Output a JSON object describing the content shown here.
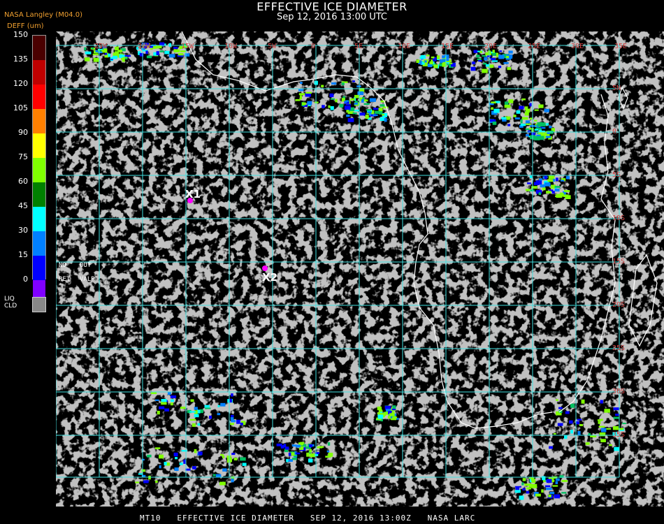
{
  "header": {
    "title": "EFFECTIVE ICE DIAMETER",
    "subtitle": "Sep 12, 2016 13:00 UTC",
    "source": "NASA Langley (M04.0)",
    "units": "DEFF (um)"
  },
  "legend": {
    "ticks": [
      "150",
      "135",
      "120",
      "105",
      "90",
      "75",
      "60",
      "45",
      "30",
      "15",
      "0"
    ],
    "colors": [
      "#4a0000",
      "#c00000",
      "#ff0000",
      "#ff8000",
      "#ffff00",
      "#80ff00",
      "#008000",
      "#00ffff",
      "#0080ff",
      "#0000ff",
      "#8000ff"
    ],
    "no_ret": "NO\nRET",
    "out_valr": "OUT\nVALR",
    "liq_cld": "LIQ\nCLD",
    "liq_color": "#888888"
  },
  "map": {
    "lon_labels": [
      "25W",
      "20W",
      "15W",
      "10W",
      "5W",
      "0",
      "5E",
      "10E",
      "15E",
      "20E",
      "25E",
      "30E",
      "35E"
    ],
    "lat_labels": [
      "5N",
      "0",
      "5S",
      "10S",
      "15S",
      "20S",
      "25S",
      "30S",
      "35S"
    ],
    "grid_color": "#40e0e0",
    "markers": [
      {
        "label": "X1",
        "color": "#ff00ff"
      },
      {
        "label": "X2",
        "color": "#ff00ff"
      }
    ]
  },
  "footer": "MT10   EFFECTIVE ICE DIAMETER   SEP 12, 2016 13:00Z   NASA LARC"
}
